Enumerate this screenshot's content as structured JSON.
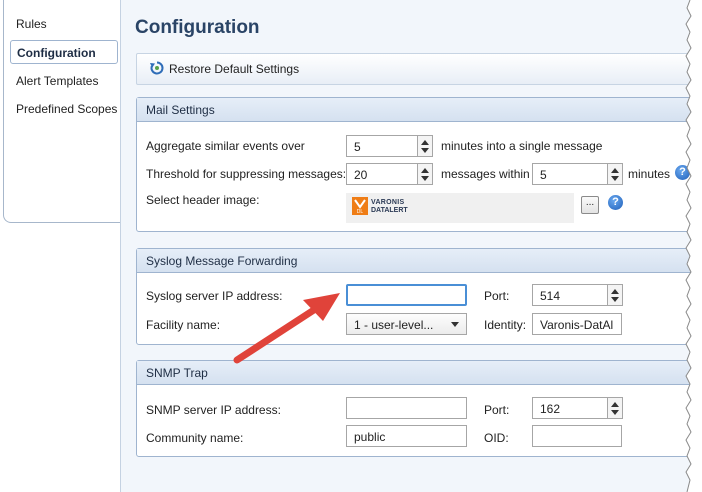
{
  "sidebar": {
    "items": [
      {
        "label": "Rules"
      },
      {
        "label": "Configuration"
      },
      {
        "label": "Alert Templates"
      },
      {
        "label": "Predefined Scopes"
      }
    ]
  },
  "page": {
    "title": "Configuration"
  },
  "toolbar": {
    "restore_label": "Restore Default Settings"
  },
  "mail": {
    "header": "Mail Settings",
    "aggregate_label": "Aggregate similar events over",
    "aggregate_value": "5",
    "aggregate_suffix": "minutes into a single message",
    "threshold_label": "Threshold for suppressing messages:",
    "threshold_value": "20",
    "within_label": "messages within",
    "within_value": "5",
    "minutes_label": "minutes",
    "header_image_label": "Select header image:",
    "logo_line1": "VARONIS",
    "logo_line2": "DATALERT",
    "logo_badge": "DL",
    "browse_label": "..."
  },
  "syslog": {
    "header": "Syslog Message Forwarding",
    "server_label": "Syslog server IP address:",
    "server_value": "",
    "port_label": "Port:",
    "port_value": "514",
    "facility_label": "Facility name:",
    "facility_value": "1 - user-level...",
    "identity_label": "Identity:",
    "identity_value": "Varonis-DatAl"
  },
  "snmp": {
    "header": "SNMP Trap",
    "server_label": "SNMP server IP address:",
    "server_value": "",
    "port_label": "Port:",
    "port_value": "162",
    "community_label": "Community name:",
    "community_value": "public",
    "oid_label": "OID:",
    "oid_value": ""
  },
  "icons": {
    "restore": "restore-icon",
    "help": "help-icon",
    "logo": "varonis-logo"
  },
  "colors": {
    "title": "#2a4466",
    "focus_border": "#4a8fd6",
    "arrow": "#e0433a",
    "help": "#1f5fb8"
  }
}
